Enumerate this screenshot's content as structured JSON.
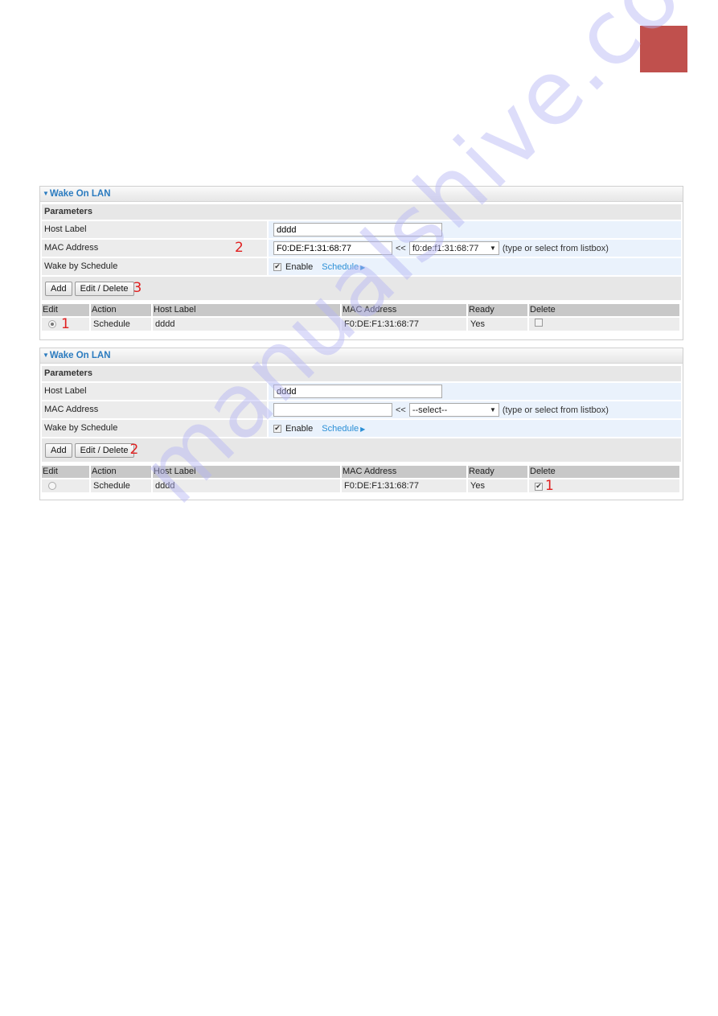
{
  "page": {
    "accent_tab_color": "#c0504d",
    "watermark": "manualshive.com"
  },
  "panels": [
    {
      "title": "Wake On LAN",
      "params_title": "Parameters",
      "fields": {
        "host_label": {
          "label": "Host Label",
          "value": "dddd"
        },
        "mac_address": {
          "label": "MAC Address",
          "value": "F0:DE:F1:31:68:77",
          "separator": "<<",
          "select_value": "f0:de:f1:31:68:77",
          "hint": "(type or select from listbox)"
        },
        "wake_by_schedule": {
          "label": "Wake by Schedule",
          "enable_label": "Enable",
          "enabled": true,
          "schedule_link": "Schedule"
        }
      },
      "buttons": {
        "add": "Add",
        "edit_delete": "Edit / Delete"
      },
      "table": {
        "headers": [
          "Edit",
          "Action",
          "Host Label",
          "MAC Address",
          "Ready",
          "Delete"
        ],
        "rows": [
          {
            "edit_selected": true,
            "action": "Schedule",
            "host_label": "dddd",
            "mac": "F0:DE:F1:31:68:77",
            "ready": "Yes",
            "delete_checked": false
          }
        ]
      },
      "callouts": {
        "mac": "2",
        "edit_button": "3",
        "edit_radio": "1"
      }
    },
    {
      "title": "Wake On LAN",
      "params_title": "Parameters",
      "fields": {
        "host_label": {
          "label": "Host Label",
          "value": "dddd"
        },
        "mac_address": {
          "label": "MAC Address",
          "value": "",
          "separator": "<<",
          "select_value": "--select--",
          "hint": "(type or select from listbox)"
        },
        "wake_by_schedule": {
          "label": "Wake by Schedule",
          "enable_label": "Enable",
          "enabled": true,
          "schedule_link": "Schedule"
        }
      },
      "buttons": {
        "add": "Add",
        "edit_delete": "Edit / Delete"
      },
      "table": {
        "headers": [
          "Edit",
          "Action",
          "Host Label",
          "MAC Address",
          "Ready",
          "Delete"
        ],
        "rows": [
          {
            "edit_selected": false,
            "action": "Schedule",
            "host_label": "dddd",
            "mac": "F0:DE:F1:31:68:77",
            "ready": "Yes",
            "delete_checked": true
          }
        ]
      },
      "callouts": {
        "edit_button": "2",
        "delete_checkbox": "1"
      }
    }
  ]
}
